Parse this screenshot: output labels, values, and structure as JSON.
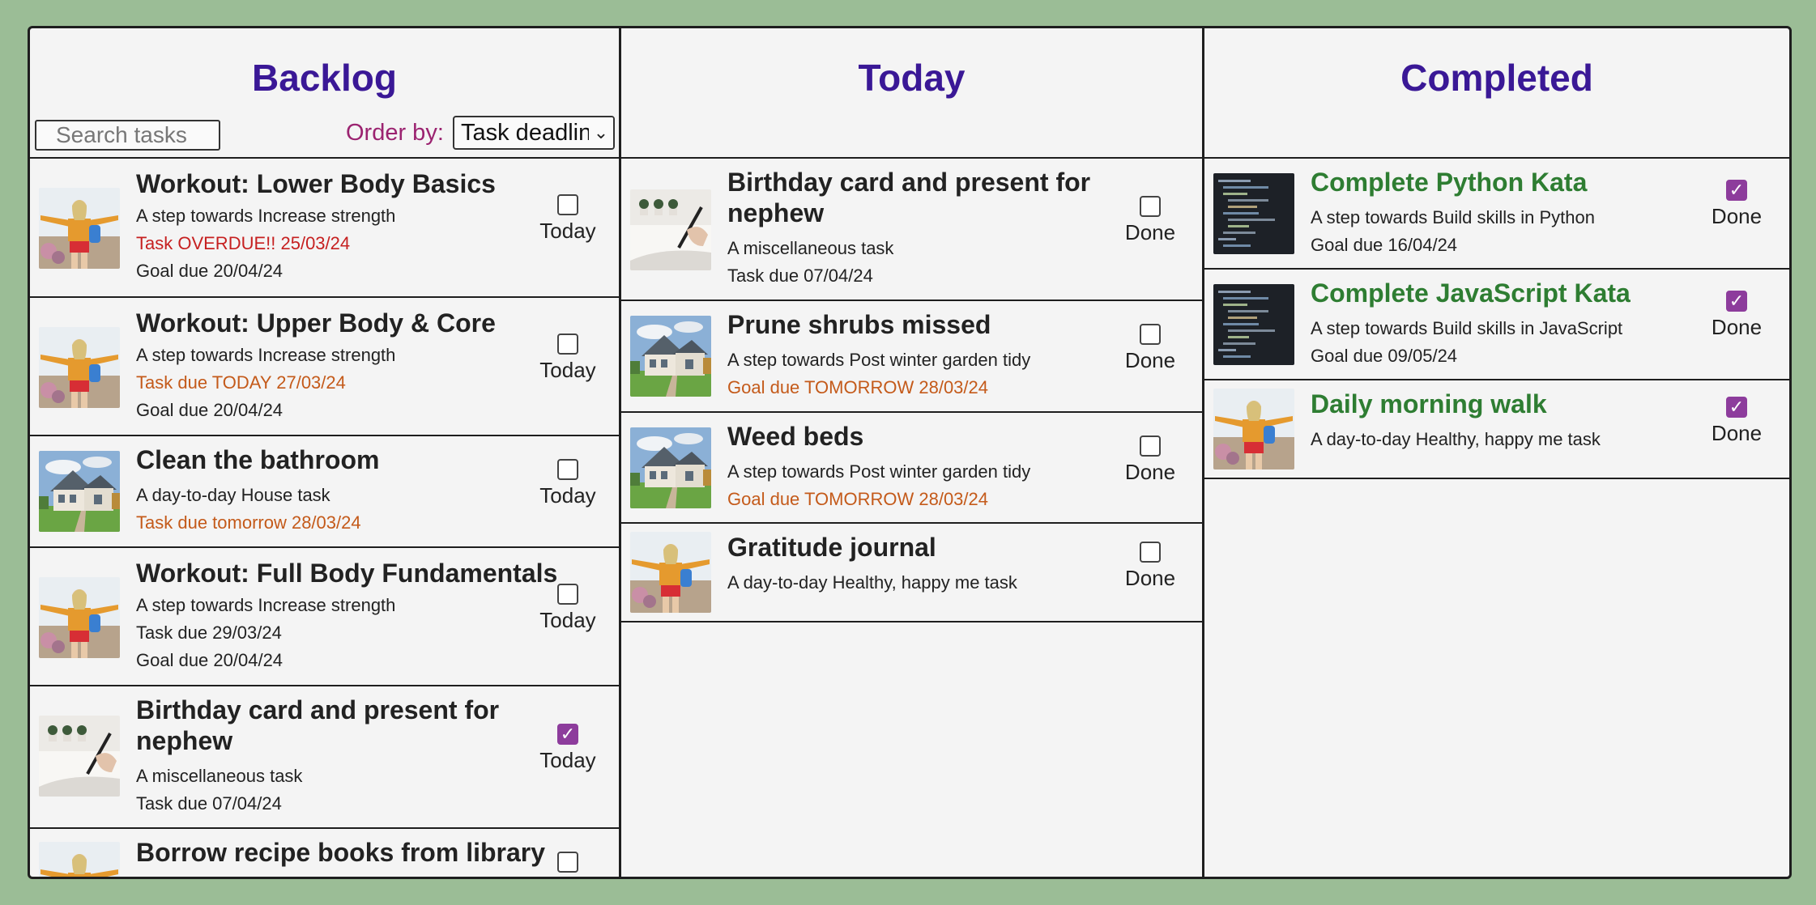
{
  "backlog": {
    "title": "Backlog",
    "search_placeholder": "Search tasks",
    "order_label": "Order by:",
    "order_value": "Task deadline",
    "cards": [
      {
        "title": "Workout: Lower Body Basics",
        "line1": "A step towards Increase strength",
        "line2": "Task OVERDUE!! 25/03/24",
        "line3": "Goal due 20/04/24",
        "toggle_label": "Today",
        "checked": false,
        "thumb": "person-icon"
      },
      {
        "title": "Workout: Upper Body & Core",
        "line1": "A step towards Increase strength",
        "line2": "Task due TODAY 27/03/24",
        "line3": "Goal due 20/04/24",
        "toggle_label": "Today",
        "checked": false,
        "thumb": "person-icon"
      },
      {
        "title": "Clean the bathroom",
        "line1": "A day-to-day House task",
        "line2": "Task due tomorrow 28/03/24",
        "toggle_label": "Today",
        "checked": false,
        "thumb": "house-icon"
      },
      {
        "title": "Workout: Full Body Fundamentals",
        "line1": "A step towards Increase strength",
        "line2": "Task due 29/03/24",
        "line3": "Goal due 20/04/24",
        "toggle_label": "Today",
        "checked": false,
        "thumb": "person-icon"
      },
      {
        "title_a": "Birthday card and present for",
        "title_b": "nephew",
        "line1": "A miscellaneous task",
        "line2": "Task due 07/04/24",
        "toggle_label": "Today",
        "checked": true,
        "thumb": "writing-icon"
      },
      {
        "title": "Borrow recipe books from library",
        "checked": false,
        "thumb": "person-icon"
      }
    ]
  },
  "today": {
    "title": "Today",
    "cards": [
      {
        "title_a": "Birthday card and present for",
        "title_b": "nephew",
        "line1": "A miscellaneous task",
        "line2": "Task due 07/04/24",
        "toggle_label": "Done",
        "checked": false,
        "thumb": "writing-icon"
      },
      {
        "title": "Prune shrubs missed",
        "line1": "A step towards Post winter garden tidy",
        "line2": "Goal due TOMORROW 28/03/24",
        "toggle_label": "Done",
        "checked": false,
        "thumb": "house-icon"
      },
      {
        "title": "Weed beds",
        "line1": "A step towards Post winter garden tidy",
        "line2": "Goal due TOMORROW 28/03/24",
        "toggle_label": "Done",
        "checked": false,
        "thumb": "house-icon"
      },
      {
        "title": "Gratitude journal",
        "line1": "A day-to-day Healthy, happy me task",
        "toggle_label": "Done",
        "checked": false,
        "thumb": "person-icon"
      }
    ]
  },
  "completed": {
    "title": "Completed",
    "cards": [
      {
        "title": "Complete Python Kata",
        "line1": "A step towards Build skills in Python",
        "line2": "Goal due 16/04/24",
        "toggle_label": "Done",
        "checked": true,
        "thumb": "code-icon"
      },
      {
        "title": "Complete JavaScript Kata",
        "line1": "A step towards Build skills in JavaScript",
        "line2": "Goal due 09/05/24",
        "toggle_label": "Done",
        "checked": true,
        "thumb": "code-icon"
      },
      {
        "title": "Daily morning walk",
        "line1": "A day-to-day Healthy, happy me task",
        "toggle_label": "Done",
        "checked": true,
        "thumb": "person-icon"
      }
    ]
  },
  "colors": {
    "background": "#9bbd96",
    "board": "#f4f4f4",
    "column_title": "#3a1896",
    "order_label": "#9b2370",
    "overdue": "#c62020",
    "due_soon": "#c45a1a",
    "completed_title": "#2e7d32",
    "checkbox_checked": "#8d3c9c"
  }
}
